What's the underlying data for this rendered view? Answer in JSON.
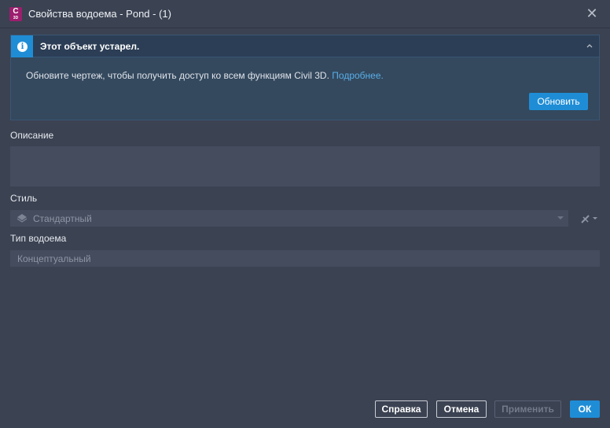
{
  "window": {
    "app_icon_letter": "C",
    "app_icon_sub": "3D",
    "title": "Свойства водоема - Pond - (1)",
    "close_icon": "close-icon"
  },
  "banner": {
    "title": "Этот объект устарел.",
    "message": "Обновите чертеж, чтобы получить доступ ко всем функциям Civil 3D.",
    "link": "Подробнее.",
    "update_button": "Обновить",
    "accent_color": "#1f8dd6"
  },
  "form": {
    "description_label": "Описание",
    "description_value": "",
    "style_label": "Стиль",
    "style_value": "Стандартный",
    "type_label": "Тип водоема",
    "type_value": "Концептуальный"
  },
  "footer": {
    "help": "Справка",
    "cancel": "Отмена",
    "apply": "Применить",
    "ok": "ОК"
  }
}
